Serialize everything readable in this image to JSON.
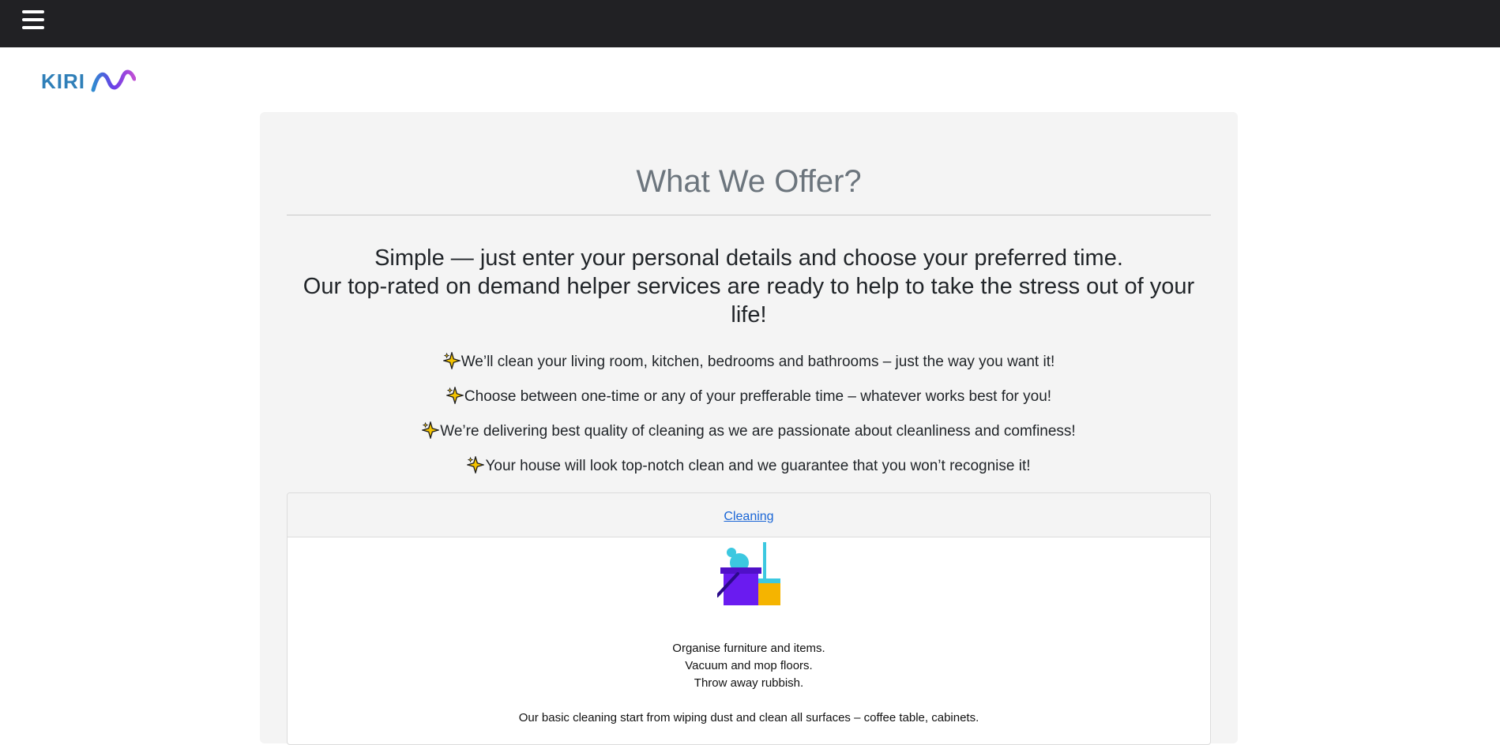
{
  "topbar": {
    "menu_icon": "hamburger-menu-icon",
    "background": "#212124"
  },
  "logo": {
    "text": "KIRI",
    "colors": [
      "#2f7fd1",
      "#6a3de8",
      "#b14bd6"
    ]
  },
  "offer": {
    "title": "What We Offer?",
    "lead_line_1": "Simple — just enter your personal details and choose your preferred time.",
    "lead_line_2": "Our top-rated on demand helper services are ready to help to take the stress out of your life!",
    "features": [
      {
        "icon": "sparkle-icon",
        "text": "We’ll clean your living room, kitchen, bedrooms and bathrooms – just the way you want it!"
      },
      {
        "icon": "sparkle-icon",
        "text": "Choose between one-time or any of your prefferable time – whatever works best for you!"
      },
      {
        "icon": "sparkle-icon",
        "text": "We’re delivering best quality of cleaning as we are passionate about cleanliness and comfiness!"
      },
      {
        "icon": "sparkle-icon",
        "text": "Your house will look top-notch clean and we guarantee that you won’t recognise it!"
      }
    ]
  },
  "service_card": {
    "link_label": "Cleaning",
    "illustration": "cleaning-bucket-mop-icon",
    "lines": [
      "Organise furniture and items.",
      "Vacuum and mop floors.",
      "Throw away rubbish."
    ],
    "description": "Our basic cleaning start from wiping dust and clean all surfaces – coffee table, cabinets."
  },
  "colors": {
    "link": "#1a66d6",
    "panel": "#f4f4f4",
    "title": "#6c757d"
  }
}
